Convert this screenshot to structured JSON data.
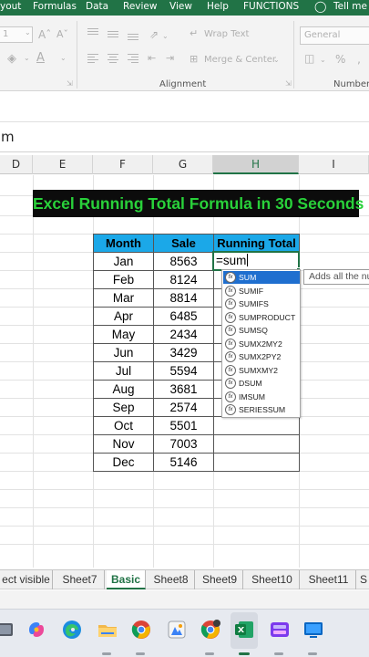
{
  "ribbon": {
    "tabs": [
      "yout",
      "Formulas",
      "Data",
      "Review",
      "View",
      "Help",
      "FUNCTIONS",
      "Tell me w"
    ],
    "font_size_value": "1",
    "wrap_text_label": "Wrap Text",
    "merge_center_label": "Merge & Center",
    "alignment_group_label": "Alignment",
    "number_format_value": "General",
    "number_group_label": "Number",
    "percent_symbol": "%"
  },
  "formula_bar": {
    "content": "m"
  },
  "columns": [
    {
      "label": "D",
      "selected": false
    },
    {
      "label": "E",
      "selected": false
    },
    {
      "label": "F",
      "selected": false
    },
    {
      "label": "G",
      "selected": false
    },
    {
      "label": "H",
      "selected": true
    },
    {
      "label": "I",
      "selected": false
    }
  ],
  "title_banner": "Excel Running Total Formula in 30 Seconds",
  "table": {
    "headers": [
      "Month",
      "Sale",
      "Running Total"
    ],
    "rows": [
      {
        "month": "Jan",
        "sale": "8563"
      },
      {
        "month": "Feb",
        "sale": "8124"
      },
      {
        "month": "Mar",
        "sale": "8814"
      },
      {
        "month": "Apr",
        "sale": "6485"
      },
      {
        "month": "May",
        "sale": "2434"
      },
      {
        "month": "Jun",
        "sale": "3429"
      },
      {
        "month": "Jul",
        "sale": "5594"
      },
      {
        "month": "Aug",
        "sale": "3681"
      },
      {
        "month": "Sep",
        "sale": "2574"
      },
      {
        "month": "Oct",
        "sale": "5501"
      },
      {
        "month": "Nov",
        "sale": "7003"
      },
      {
        "month": "Dec",
        "sale": "5146"
      }
    ]
  },
  "active_cell": {
    "text": "=sum"
  },
  "autocomplete": {
    "icon_text": "fx",
    "items": [
      {
        "label": "SUM",
        "selected": true
      },
      {
        "label": "SUMIF",
        "selected": false
      },
      {
        "label": "SUMIFS",
        "selected": false
      },
      {
        "label": "SUMPRODUCT",
        "selected": false
      },
      {
        "label": "SUMSQ",
        "selected": false
      },
      {
        "label": "SUMX2MY2",
        "selected": false
      },
      {
        "label": "SUMX2PY2",
        "selected": false
      },
      {
        "label": "SUMXMY2",
        "selected": false
      },
      {
        "label": "DSUM",
        "selected": false
      },
      {
        "label": "IMSUM",
        "selected": false
      },
      {
        "label": "SERIESSUM",
        "selected": false
      }
    ]
  },
  "tooltip": "Adds all the nu",
  "sheet_tabs": [
    {
      "label": "ect visible",
      "active": false
    },
    {
      "label": "Sheet7",
      "active": false
    },
    {
      "label": "Basic",
      "active": true
    },
    {
      "label": "Sheet8",
      "active": false
    },
    {
      "label": "Sheet9",
      "active": false
    },
    {
      "label": "Sheet10",
      "active": false
    },
    {
      "label": "Sheet11",
      "active": false
    },
    {
      "label": "S",
      "active": false
    }
  ],
  "taskbar": {
    "apps": [
      "file-explorer-edge",
      "copilot",
      "edge",
      "file-explorer",
      "chrome",
      "paint",
      "chrome-profile",
      "excel",
      "video-editor",
      "remote-desktop"
    ]
  },
  "colors": {
    "excel_green": "#217346",
    "banner_text": "#29d13a",
    "header_fill": "#1ba8e8",
    "autocomplete_selected": "#1f6fcf"
  }
}
